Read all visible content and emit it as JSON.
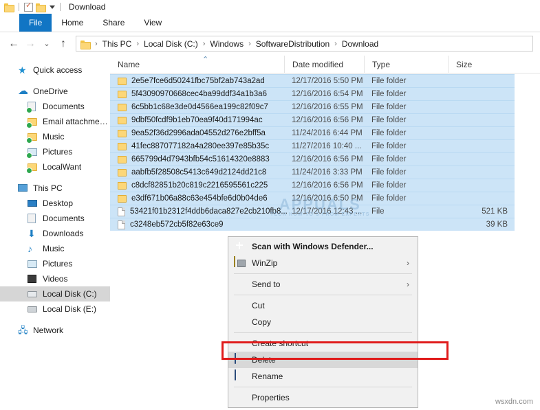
{
  "window": {
    "title": "Download",
    "quick_access_icons": [
      "folder-icon",
      "properties-icon",
      "new-folder-icon",
      "customize-dropdown-icon"
    ]
  },
  "ribbon": {
    "tabs": [
      {
        "label": "File",
        "active": true
      },
      {
        "label": "Home",
        "active": false
      },
      {
        "label": "Share",
        "active": false
      },
      {
        "label": "View",
        "active": false
      }
    ]
  },
  "address_bar": {
    "back_icon": "arrow-left-icon",
    "forward_icon": "arrow-right-icon",
    "recent_icon": "chevron-down-icon",
    "up_icon": "arrow-up-icon",
    "folder_icon": "folder-icon",
    "crumbs": [
      "This PC",
      "Local Disk (C:)",
      "Windows",
      "SoftwareDistribution",
      "Download"
    ],
    "separator": "›"
  },
  "sidebar": {
    "groups": [
      {
        "items": [
          {
            "label": "Quick access",
            "icon": "star-icon",
            "level": 0,
            "selected": false
          }
        ]
      },
      {
        "items": [
          {
            "label": "OneDrive",
            "icon": "cloud-icon",
            "level": 0,
            "selected": false
          },
          {
            "label": "Documents",
            "icon": "document-sync-icon",
            "level": 1,
            "selected": false
          },
          {
            "label": "Email attachments",
            "icon": "folder-sync-icon",
            "level": 1,
            "selected": false
          },
          {
            "label": "Music",
            "icon": "folder-sync-icon",
            "level": 1,
            "selected": false
          },
          {
            "label": "Pictures",
            "icon": "picture-sync-icon",
            "level": 1,
            "selected": false
          },
          {
            "label": "LocalWant",
            "icon": "folder-sync-icon",
            "level": 1,
            "selected": false
          }
        ]
      },
      {
        "items": [
          {
            "label": "This PC",
            "icon": "computer-icon",
            "level": 0,
            "selected": false
          },
          {
            "label": "Desktop",
            "icon": "desktop-icon",
            "level": 1,
            "selected": false
          },
          {
            "label": "Documents",
            "icon": "document-icon",
            "level": 1,
            "selected": false
          },
          {
            "label": "Downloads",
            "icon": "download-arrow-icon",
            "level": 1,
            "selected": false
          },
          {
            "label": "Music",
            "icon": "music-note-icon",
            "level": 1,
            "selected": false
          },
          {
            "label": "Pictures",
            "icon": "picture-icon",
            "level": 1,
            "selected": false
          },
          {
            "label": "Videos",
            "icon": "video-icon",
            "level": 1,
            "selected": false
          },
          {
            "label": "Local Disk (C:)",
            "icon": "system-drive-icon",
            "level": 1,
            "selected": true
          },
          {
            "label": "Local Disk (E:)",
            "icon": "drive-icon",
            "level": 1,
            "selected": false
          }
        ]
      },
      {
        "items": [
          {
            "label": "Network",
            "icon": "network-icon",
            "level": 0,
            "selected": false
          }
        ]
      }
    ]
  },
  "file_list": {
    "columns": [
      {
        "label": "Name",
        "sorted": true,
        "sort_direction": "ascending"
      },
      {
        "label": "Date modified",
        "sorted": false
      },
      {
        "label": "Type",
        "sorted": false
      },
      {
        "label": "Size",
        "sorted": false
      }
    ],
    "sort_indicator": "⌃",
    "rows": [
      {
        "name": "2e5e7fce6d50241fbc75bf2ab743a2ad",
        "date": "12/17/2016 5:50 PM",
        "type": "File folder",
        "size": "",
        "kind": "folder",
        "selected": true
      },
      {
        "name": "5f43090970668cec4ba99ddf34a1b3a6",
        "date": "12/16/2016 6:54 PM",
        "type": "File folder",
        "size": "",
        "kind": "folder",
        "selected": true
      },
      {
        "name": "6c5bb1c68e3de0d4566ea199c82f09c7",
        "date": "12/16/2016 6:55 PM",
        "type": "File folder",
        "size": "",
        "kind": "folder",
        "selected": true
      },
      {
        "name": "9dbf50fcdf9b1eb70ea9f40d171994ac",
        "date": "12/16/2016 6:56 PM",
        "type": "File folder",
        "size": "",
        "kind": "folder",
        "selected": true
      },
      {
        "name": "9ea52f36d2996ada04552d276e2bff5a",
        "date": "11/24/2016 6:44 PM",
        "type": "File folder",
        "size": "",
        "kind": "folder",
        "selected": true
      },
      {
        "name": "41fec887077182a4a280ee397e85b35c",
        "date": "11/27/2016 10:40 ...",
        "type": "File folder",
        "size": "",
        "kind": "folder",
        "selected": true
      },
      {
        "name": "665799d4d7943bfb54c51614320e8883",
        "date": "12/16/2016 6:56 PM",
        "type": "File folder",
        "size": "",
        "kind": "folder",
        "selected": true
      },
      {
        "name": "aabfb5f28508c5413c649d2124dd21c8",
        "date": "11/24/2016 3:33 PM",
        "type": "File folder",
        "size": "",
        "kind": "folder",
        "selected": true
      },
      {
        "name": "c8dcf82851b20c819c2216595561c225",
        "date": "12/16/2016 6:56 PM",
        "type": "File folder",
        "size": "",
        "kind": "folder",
        "selected": true
      },
      {
        "name": "e3df671b06a88c63e454bfe6d0b04de6",
        "date": "12/16/2016 6:50 PM",
        "type": "File folder",
        "size": "",
        "kind": "folder",
        "selected": true
      },
      {
        "name": "53421f01b2312f4ddb6daca827e2cb210fb8...",
        "date": "12/17/2016 12:43 ...",
        "type": "File",
        "size": "521 KB",
        "kind": "file",
        "selected": true
      },
      {
        "name": "c3248eb572cb5f82e63ce9",
        "date": "",
        "type": "",
        "size": "39 KB",
        "kind": "file",
        "selected": true
      }
    ]
  },
  "context_menu": {
    "items": [
      {
        "label": "Scan with Windows Defender...",
        "icon": "windows-defender-shield-icon",
        "bold": true,
        "submenu": false,
        "hover": false,
        "separator_after": false
      },
      {
        "label": "WinZip",
        "icon": "winzip-icon",
        "bold": false,
        "submenu": true,
        "hover": false,
        "separator_after": true
      },
      {
        "label": "Send to",
        "icon": "",
        "bold": false,
        "submenu": true,
        "hover": false,
        "separator_after": true
      },
      {
        "label": "Cut",
        "icon": "",
        "bold": false,
        "submenu": false,
        "hover": false,
        "separator_after": false
      },
      {
        "label": "Copy",
        "icon": "",
        "bold": false,
        "submenu": false,
        "hover": false,
        "separator_after": true
      },
      {
        "label": "Create shortcut",
        "icon": "",
        "bold": false,
        "submenu": false,
        "hover": false,
        "separator_after": false
      },
      {
        "label": "Delete",
        "icon": "uac-shield-icon",
        "bold": false,
        "submenu": false,
        "hover": true,
        "separator_after": false
      },
      {
        "label": "Rename",
        "icon": "uac-shield-icon",
        "bold": false,
        "submenu": false,
        "hover": false,
        "separator_after": true
      },
      {
        "label": "Properties",
        "icon": "",
        "bold": false,
        "submenu": false,
        "hover": false,
        "separator_after": false
      }
    ],
    "submenu_arrow": "›"
  },
  "annotation": {
    "highlight_color": "#e01b1b",
    "target": "Delete"
  },
  "watermark": {
    "text": "APPUALS",
    "subtext": "TECH HOW-TO'S FROM EXPERTS"
  },
  "footer": {
    "credit": "wsxdn.com"
  }
}
